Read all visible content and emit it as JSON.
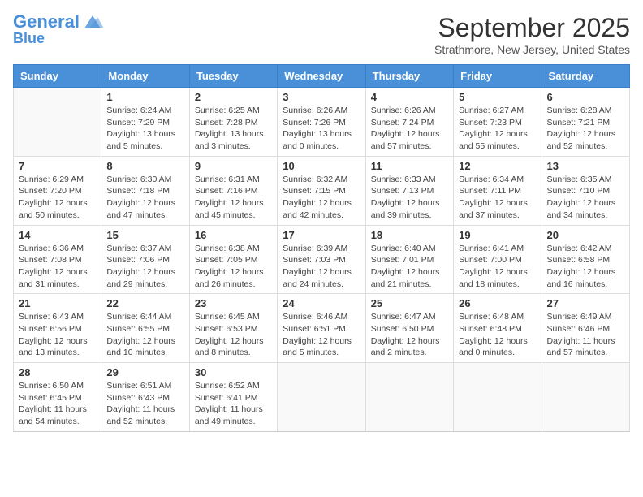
{
  "header": {
    "logo_line1": "General",
    "logo_line2": "Blue",
    "month": "September 2025",
    "location": "Strathmore, New Jersey, United States"
  },
  "weekdays": [
    "Sunday",
    "Monday",
    "Tuesday",
    "Wednesday",
    "Thursday",
    "Friday",
    "Saturday"
  ],
  "weeks": [
    [
      {
        "day": "",
        "detail": ""
      },
      {
        "day": "1",
        "detail": "Sunrise: 6:24 AM\nSunset: 7:29 PM\nDaylight: 13 hours\nand 5 minutes."
      },
      {
        "day": "2",
        "detail": "Sunrise: 6:25 AM\nSunset: 7:28 PM\nDaylight: 13 hours\nand 3 minutes."
      },
      {
        "day": "3",
        "detail": "Sunrise: 6:26 AM\nSunset: 7:26 PM\nDaylight: 13 hours\nand 0 minutes."
      },
      {
        "day": "4",
        "detail": "Sunrise: 6:26 AM\nSunset: 7:24 PM\nDaylight: 12 hours\nand 57 minutes."
      },
      {
        "day": "5",
        "detail": "Sunrise: 6:27 AM\nSunset: 7:23 PM\nDaylight: 12 hours\nand 55 minutes."
      },
      {
        "day": "6",
        "detail": "Sunrise: 6:28 AM\nSunset: 7:21 PM\nDaylight: 12 hours\nand 52 minutes."
      }
    ],
    [
      {
        "day": "7",
        "detail": "Sunrise: 6:29 AM\nSunset: 7:20 PM\nDaylight: 12 hours\nand 50 minutes."
      },
      {
        "day": "8",
        "detail": "Sunrise: 6:30 AM\nSunset: 7:18 PM\nDaylight: 12 hours\nand 47 minutes."
      },
      {
        "day": "9",
        "detail": "Sunrise: 6:31 AM\nSunset: 7:16 PM\nDaylight: 12 hours\nand 45 minutes."
      },
      {
        "day": "10",
        "detail": "Sunrise: 6:32 AM\nSunset: 7:15 PM\nDaylight: 12 hours\nand 42 minutes."
      },
      {
        "day": "11",
        "detail": "Sunrise: 6:33 AM\nSunset: 7:13 PM\nDaylight: 12 hours\nand 39 minutes."
      },
      {
        "day": "12",
        "detail": "Sunrise: 6:34 AM\nSunset: 7:11 PM\nDaylight: 12 hours\nand 37 minutes."
      },
      {
        "day": "13",
        "detail": "Sunrise: 6:35 AM\nSunset: 7:10 PM\nDaylight: 12 hours\nand 34 minutes."
      }
    ],
    [
      {
        "day": "14",
        "detail": "Sunrise: 6:36 AM\nSunset: 7:08 PM\nDaylight: 12 hours\nand 31 minutes."
      },
      {
        "day": "15",
        "detail": "Sunrise: 6:37 AM\nSunset: 7:06 PM\nDaylight: 12 hours\nand 29 minutes."
      },
      {
        "day": "16",
        "detail": "Sunrise: 6:38 AM\nSunset: 7:05 PM\nDaylight: 12 hours\nand 26 minutes."
      },
      {
        "day": "17",
        "detail": "Sunrise: 6:39 AM\nSunset: 7:03 PM\nDaylight: 12 hours\nand 24 minutes."
      },
      {
        "day": "18",
        "detail": "Sunrise: 6:40 AM\nSunset: 7:01 PM\nDaylight: 12 hours\nand 21 minutes."
      },
      {
        "day": "19",
        "detail": "Sunrise: 6:41 AM\nSunset: 7:00 PM\nDaylight: 12 hours\nand 18 minutes."
      },
      {
        "day": "20",
        "detail": "Sunrise: 6:42 AM\nSunset: 6:58 PM\nDaylight: 12 hours\nand 16 minutes."
      }
    ],
    [
      {
        "day": "21",
        "detail": "Sunrise: 6:43 AM\nSunset: 6:56 PM\nDaylight: 12 hours\nand 13 minutes."
      },
      {
        "day": "22",
        "detail": "Sunrise: 6:44 AM\nSunset: 6:55 PM\nDaylight: 12 hours\nand 10 minutes."
      },
      {
        "day": "23",
        "detail": "Sunrise: 6:45 AM\nSunset: 6:53 PM\nDaylight: 12 hours\nand 8 minutes."
      },
      {
        "day": "24",
        "detail": "Sunrise: 6:46 AM\nSunset: 6:51 PM\nDaylight: 12 hours\nand 5 minutes."
      },
      {
        "day": "25",
        "detail": "Sunrise: 6:47 AM\nSunset: 6:50 PM\nDaylight: 12 hours\nand 2 minutes."
      },
      {
        "day": "26",
        "detail": "Sunrise: 6:48 AM\nSunset: 6:48 PM\nDaylight: 12 hours\nand 0 minutes."
      },
      {
        "day": "27",
        "detail": "Sunrise: 6:49 AM\nSunset: 6:46 PM\nDaylight: 11 hours\nand 57 minutes."
      }
    ],
    [
      {
        "day": "28",
        "detail": "Sunrise: 6:50 AM\nSunset: 6:45 PM\nDaylight: 11 hours\nand 54 minutes."
      },
      {
        "day": "29",
        "detail": "Sunrise: 6:51 AM\nSunset: 6:43 PM\nDaylight: 11 hours\nand 52 minutes."
      },
      {
        "day": "30",
        "detail": "Sunrise: 6:52 AM\nSunset: 6:41 PM\nDaylight: 11 hours\nand 49 minutes."
      },
      {
        "day": "",
        "detail": ""
      },
      {
        "day": "",
        "detail": ""
      },
      {
        "day": "",
        "detail": ""
      },
      {
        "day": "",
        "detail": ""
      }
    ]
  ]
}
